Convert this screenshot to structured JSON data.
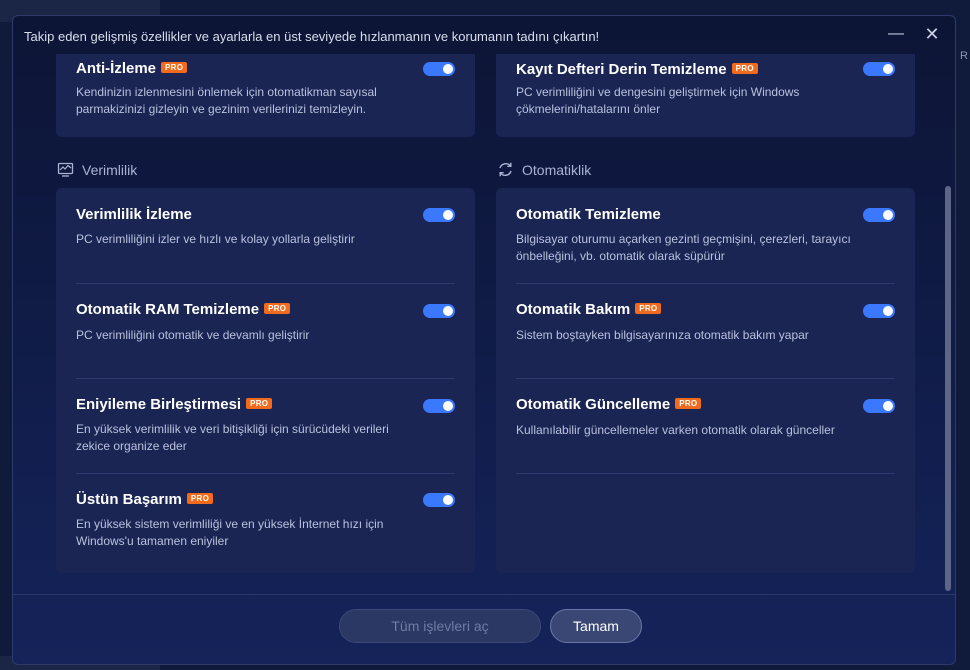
{
  "window": {
    "title": "Takip eden gelişmiş özellikler ve ayarlarla en üst seviyede hızlanmanın ve korumanın tadını çıkartın!",
    "minimize_glyph": "—",
    "close_glyph": "✕",
    "bg_edge_char": "R"
  },
  "pro_badge": "PRO",
  "top_cards": {
    "left": {
      "title": "Anti-İzleme",
      "pro": true,
      "desc": "Kendinizin izlenmesini önlemek için otomatikman sayısal parmakizinizi gizleyin ve gezinim verilerinizi temizleyin.",
      "enabled": true
    },
    "right": {
      "title": "Kayıt Defteri Derin Temizleme",
      "pro": true,
      "desc": "PC verimliliğini ve dengesini geliştirmek için Windows çökmelerini/hatalarını önler",
      "enabled": true
    }
  },
  "sections": {
    "performance": {
      "label": "Verimlilik",
      "icon": "chart-monitor-icon",
      "items": [
        {
          "title": "Verimlilik İzleme",
          "pro": false,
          "desc": "PC verimliliğini izler ve hızlı ve kolay yollarla geliştirir",
          "enabled": true
        },
        {
          "title": "Otomatik RAM Temizleme",
          "pro": true,
          "desc": "PC verimliliğini otomatik ve devamlı geliştirir",
          "enabled": true
        },
        {
          "title": "Eniyileme Birleştirmesi",
          "pro": true,
          "desc": "En yüksek verimlilik ve veri bitişikliği için sürücüdeki verileri zekice organize eder",
          "enabled": true
        },
        {
          "title": "Üstün Başarım",
          "pro": true,
          "desc": "En yüksek sistem verimliliği ve en yüksek İnternet hızı için Windows'u tamamen eniyiler",
          "enabled": true
        }
      ]
    },
    "automation": {
      "label": "Otomatiklik",
      "icon": "refresh-icon",
      "items": [
        {
          "title": "Otomatik Temizleme",
          "pro": false,
          "desc": "Bilgisayar oturumu açarken gezinti geçmişini, çerezleri, tarayıcı önbelleğini, vb. otomatik olarak süpürür",
          "enabled": true
        },
        {
          "title": "Otomatik Bakım",
          "pro": true,
          "desc": "Sistem boştayken bilgisayarınıza otomatik bakım yapar",
          "enabled": true
        },
        {
          "title": "Otomatik Güncelleme",
          "pro": true,
          "desc": "Kullanılabilir güncellemeler varken otomatik olarak günceller",
          "enabled": true
        }
      ]
    }
  },
  "footer": {
    "open_all_label": "Tüm işlevleri aç",
    "ok_label": "Tamam"
  },
  "colors": {
    "toggle_on": "#3a78ff",
    "pro_badge": "#f26a1b",
    "card_bg": "#1a2553"
  }
}
